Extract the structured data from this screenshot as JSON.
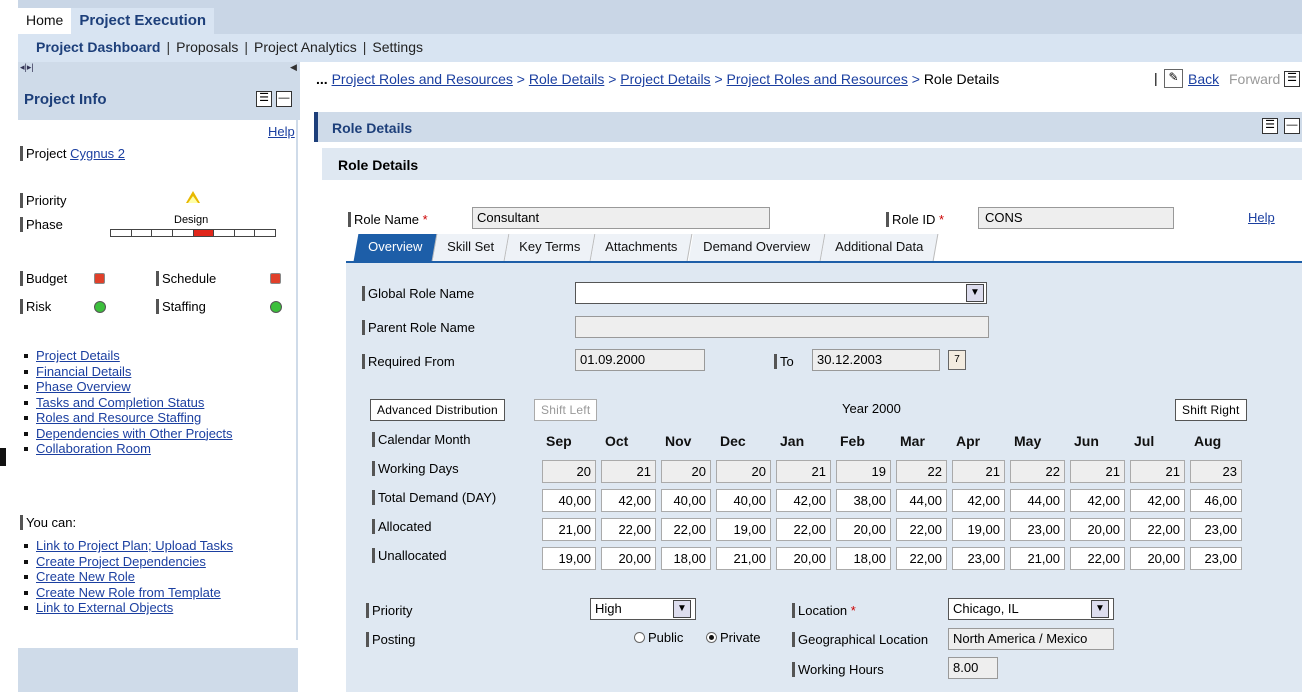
{
  "top_tabs": [
    "Home",
    "Project Execution"
  ],
  "sub_nav": [
    "Project Dashboard",
    "Proposals",
    "Project Analytics",
    "Settings"
  ],
  "left": {
    "title": "Project Info",
    "help": "Help",
    "project_label": "Project",
    "project_name": "Cygnus 2",
    "priority_label": "Priority",
    "phase_label": "Phase",
    "phase_value": "Design",
    "budget": "Budget",
    "schedule": "Schedule",
    "risk": "Risk",
    "staffing": "Staffing",
    "links": [
      "Project Details",
      "Financial Details",
      "Phase Overview",
      "Tasks and Completion Status",
      "Roles and Resource Staffing",
      "Dependencies with Other Projects",
      "Collaboration Room"
    ],
    "you_can": "You can:",
    "actions": [
      "Link to Project Plan; Upload Tasks",
      "Create Project Dependencies",
      "Create New Role",
      "Create New Role from Template",
      "Link to External Objects"
    ]
  },
  "breadcrumb": {
    "prefix": "...",
    "items": [
      "Project Roles and Resources",
      "Role Details",
      "Project Details",
      "Project Roles and Resources"
    ],
    "current": "Role Details",
    "back": "Back",
    "forward": "Forward"
  },
  "header": {
    "title": "Role Details",
    "section": "Role Details"
  },
  "role": {
    "name_label": "Role Name",
    "name_value": "Consultant",
    "id_label": "Role ID",
    "id_value": "CONS",
    "req": "*",
    "help": "Help"
  },
  "tabs": [
    "Overview",
    "Skill Set",
    "Key Terms",
    "Attachments",
    "Demand Overview",
    "Additional Data"
  ],
  "form": {
    "global_role": "Global Role Name",
    "parent_role": "Parent Role Name",
    "required_from": "Required From",
    "from_date": "01.09.2000",
    "to_label": "To",
    "to_date": "30.12.2003"
  },
  "distribution": {
    "advanced": "Advanced Distribution",
    "shift_left": "Shift Left",
    "year": "Year 2000",
    "shift_right": "Shift Right",
    "months": [
      "Sep",
      "Oct",
      "Nov",
      "Dec",
      "Jan",
      "Feb",
      "Mar",
      "Apr",
      "May",
      "Jun",
      "Jul",
      "Aug"
    ],
    "rows": [
      {
        "label": "Calendar Month"
      },
      {
        "label": "Working Days",
        "values": [
          "20",
          "21",
          "20",
          "20",
          "21",
          "19",
          "22",
          "21",
          "22",
          "21",
          "21",
          "23"
        ]
      },
      {
        "label": "Total Demand (DAY)",
        "values": [
          "40,00",
          "42,00",
          "40,00",
          "40,00",
          "42,00",
          "38,00",
          "44,00",
          "42,00",
          "44,00",
          "42,00",
          "42,00",
          "46,00"
        ]
      },
      {
        "label": "Allocated",
        "values": [
          "21,00",
          "22,00",
          "22,00",
          "19,00",
          "22,00",
          "20,00",
          "22,00",
          "19,00",
          "23,00",
          "20,00",
          "22,00",
          "23,00"
        ]
      },
      {
        "label": "Unallocated",
        "values": [
          "19,00",
          "20,00",
          "18,00",
          "21,00",
          "20,00",
          "18,00",
          "22,00",
          "23,00",
          "21,00",
          "22,00",
          "20,00",
          "23,00"
        ]
      }
    ]
  },
  "bottom": {
    "priority_label": "Priority",
    "priority_value": "High",
    "posting_label": "Posting",
    "public": "Public",
    "private": "Private",
    "location_label": "Location",
    "location_value": "Chicago, IL",
    "geo_label": "Geographical Location",
    "geo_value": "North America / Mexico",
    "hours_label": "Working Hours",
    "hours_value": "8.00"
  },
  "colors": {
    "accent": "#1d5ea8",
    "nav_bg": "#d8e4f2",
    "panel_bg": "#dfe8f2",
    "red": "#e0402a",
    "green": "#3cbf3c"
  }
}
